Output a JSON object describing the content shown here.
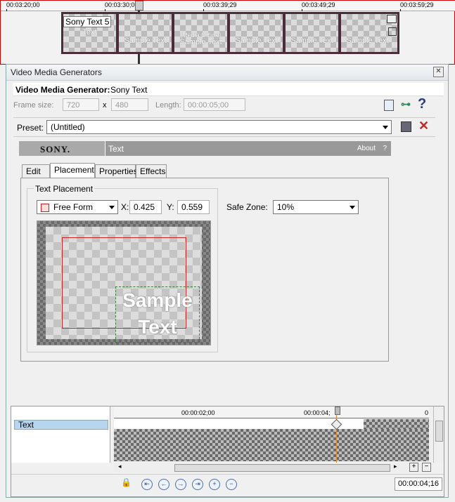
{
  "top_ruler": {
    "ticks": [
      "00:03:20;00",
      "00:03:30;00",
      "00:03:39;29",
      "00:03:49;29",
      "00:03:59;29"
    ]
  },
  "top_clip": {
    "label": "Sony Text 5",
    "thumb_texts": [
      "Text",
      "Sample Text",
      "Sample Text",
      "Sample Text",
      "Sample Text",
      "Sample Text"
    ],
    "offline_text": "(Media Offline)"
  },
  "dialog": {
    "title": "Video Media Generators",
    "generator_label": "Video Media Generator:",
    "generator_name": "Sony Text",
    "frame_size_label": "Frame size:",
    "frame_w": "720",
    "times": "x",
    "frame_h": "480",
    "length_label": "Length:",
    "length": "00:00:05;00",
    "help": "?",
    "preset_label": "Preset:",
    "preset_value": "(Untitled)"
  },
  "plugin": {
    "brand": "SONY.",
    "name": "Text",
    "about": "About",
    "about_q": "?"
  },
  "tabs": [
    {
      "label": "Edit"
    },
    {
      "label": "Placement",
      "active": true
    },
    {
      "label": "Properties"
    },
    {
      "label": "Effects"
    }
  ],
  "placement": {
    "group_label": "Text Placement",
    "mode": "Free Form",
    "x_label": "X:",
    "x_value": "0.425",
    "y_label": "Y:",
    "y_value": "0.559",
    "safe_zone_label": "Safe Zone:",
    "safe_zone_value": "10%",
    "preview_text_1": "Sample",
    "preview_text_2": "Text"
  },
  "keyframes": {
    "track_label": "Text",
    "ruler_ticks": [
      "00:00:02;00",
      "00:00:04;",
      "0"
    ],
    "time_display": "00:00:04;16",
    "playhead_fraction": 0.87
  },
  "colors": {
    "accent_red": "#cc2222",
    "sony_bar": "#a9a9a9",
    "track_selected": "#b9d5ee",
    "plugin_name_bar": "#999999"
  }
}
